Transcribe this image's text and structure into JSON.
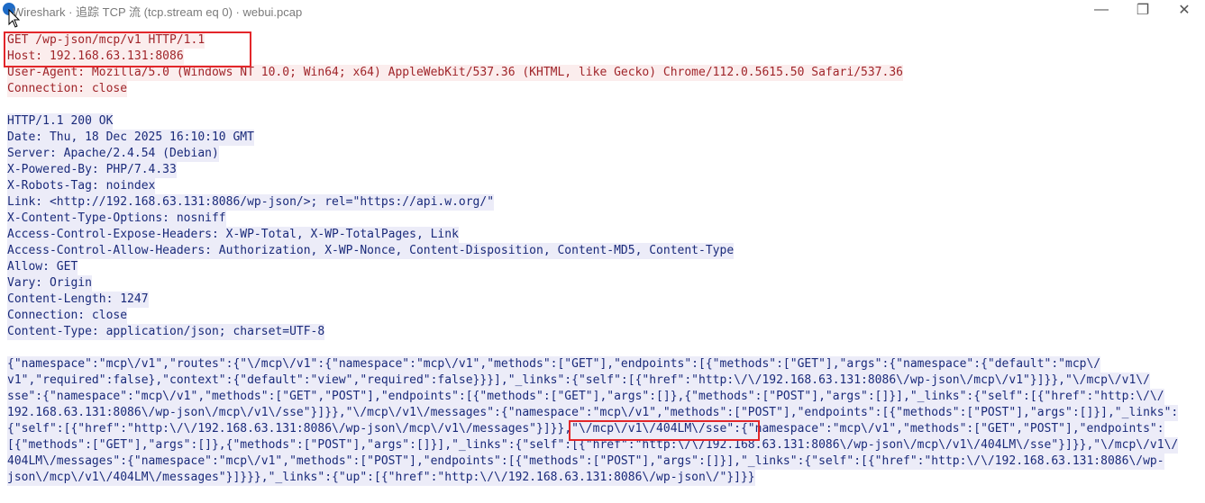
{
  "window": {
    "title": "Wireshark · 追踪 TCP 流 (tcp.stream eq 0) · webui.pcap",
    "controls": {
      "minimize": "—",
      "maximize": "❐",
      "close": "✕"
    }
  },
  "request_lines": [
    "GET /wp-json/mcp/v1 HTTP/1.1",
    "Host: 192.168.63.131:8086",
    "User-Agent: Mozilla/5.0 (Windows NT 10.0; Win64; x64) AppleWebKit/537.36 (KHTML, like Gecko) Chrome/112.0.5615.50 Safari/537.36",
    "Connection: close"
  ],
  "response_header_lines": [
    "HTTP/1.1 200 OK",
    "Date: Thu, 18 Dec 2025 16:10:10 GMT",
    "Server: Apache/2.4.54 (Debian)",
    "X-Powered-By: PHP/7.4.33",
    "X-Robots-Tag: noindex",
    "Link: <http://192.168.63.131:8086/wp-json/>; rel=\"https://api.w.org/\"",
    "X-Content-Type-Options: nosniff",
    "Access-Control-Expose-Headers: X-WP-Total, X-WP-TotalPages, Link",
    "Access-Control-Allow-Headers: Authorization, X-WP-Nonce, Content-Disposition, Content-MD5, Content-Type",
    "Allow: GET",
    "Vary: Origin",
    "Content-Length: 1247",
    "Connection: close",
    "Content-Type: application/json; charset=UTF-8"
  ],
  "response_body_lines": [
    "{\"namespace\":\"mcp\\/v1\",\"routes\":{\"\\/mcp\\/v1\":{\"namespace\":\"mcp\\/v1\",\"methods\":[\"GET\"],\"endpoints\":[{\"methods\":[\"GET\"],\"args\":{\"namespace\":{\"default\":\"mcp\\/",
    "v1\",\"required\":false},\"context\":{\"default\":\"view\",\"required\":false}}}],\"_links\":{\"self\":[{\"href\":\"http:\\/\\/192.168.63.131:8086\\/wp-json\\/mcp\\/v1\"}]}},\"\\/mcp\\/v1\\/",
    "sse\":{\"namespace\":\"mcp\\/v1\",\"methods\":[\"GET\",\"POST\"],\"endpoints\":[{\"methods\":[\"GET\"],\"args\":[]},{\"methods\":[\"POST\"],\"args\":[]}],\"_links\":{\"self\":[{\"href\":\"http:\\/\\/",
    "192.168.63.131:8086\\/wp-json\\/mcp\\/v1\\/sse\"}]}},\"\\/mcp\\/v1\\/messages\":{\"namespace\":\"mcp\\/v1\",\"methods\":[\"POST\"],\"endpoints\":[{\"methods\":[\"POST\"],\"args\":[]}],\"_links\":",
    "{\"self\":[{\"href\":\"http:\\/\\/192.168.63.131:8086\\/wp-json\\/mcp\\/v1\\/messages\"}]}},\"\\/mcp\\/v1\\/404LM\\/sse\":{\"namespace\":\"mcp\\/v1\",\"methods\":[\"GET\",\"POST\"],\"endpoints\":",
    "[{\"methods\":[\"GET\"],\"args\":[]},{\"methods\":[\"POST\"],\"args\":[]}],\"_links\":{\"self\":[{\"href\":\"http:\\/\\/192.168.63.131:8086\\/wp-json\\/mcp\\/v1\\/404LM\\/sse\"}]}},\"\\/mcp\\/v1\\/",
    "404LM\\/messages\":{\"namespace\":\"mcp\\/v1\",\"methods\":[\"POST\"],\"endpoints\":[{\"methods\":[\"POST\"],\"args\":[]}],\"_links\":{\"self\":[{\"href\":\"http:\\/\\/192.168.63.131:8086\\/wp-",
    "json\\/mcp\\/v1\\/404LM\\/messages\"}]}}},\"_links\":{\"up\":[{\"href\":\"http:\\/\\/192.168.63.131:8086\\/wp-json\\/\"}]}}"
  ],
  "colors": {
    "request_text": "#a0252a",
    "request_bg": "#fbeded",
    "response_text": "#1a2a7a",
    "response_bg": "#ececf8",
    "highlight_box": "#e3262a"
  },
  "icons": {
    "app": "wireshark-fin-icon",
    "cursor": "mouse-pointer-icon"
  }
}
